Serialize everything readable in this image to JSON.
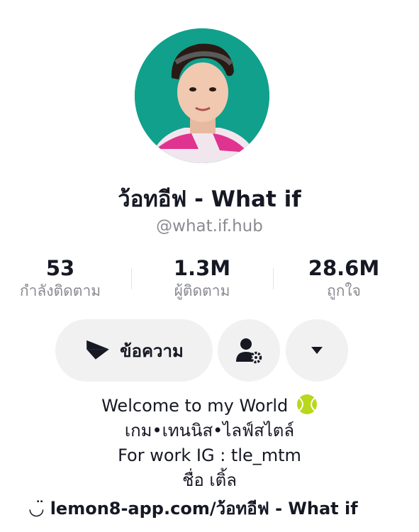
{
  "profile": {
    "display_name": "ว้อทอีฟ - What if",
    "handle": "@what.if.hub"
  },
  "stats": {
    "following": {
      "value": "53",
      "label": "กำลังติดตาม"
    },
    "followers": {
      "value": "1.3M",
      "label": "ผู้ติดตาม"
    },
    "likes": {
      "value": "28.6M",
      "label": "ถูกใจ"
    }
  },
  "actions": {
    "message_label": "ข้อความ",
    "message_icon": "send-icon",
    "manage_icon": "user-settings-icon",
    "more_icon": "dropdown-caret-icon"
  },
  "bio": {
    "line1": "Welcome to my World",
    "line1_icon": "tennis-ball-icon",
    "line2": "เกม•เทนนิส•ไลฟ์สไตล์",
    "line3": "For work IG : tle_mtm",
    "line4": "ชื่อ เติ้ล"
  },
  "link": {
    "icon": "link-icon",
    "text": "lemon8-app.com/ว้อทอีฟ - What if"
  },
  "colors": {
    "avatar_bg": "#11a08c",
    "button_bg": "#f1f1f2",
    "text_primary": "#161823",
    "text_secondary": "#8a8b91"
  }
}
